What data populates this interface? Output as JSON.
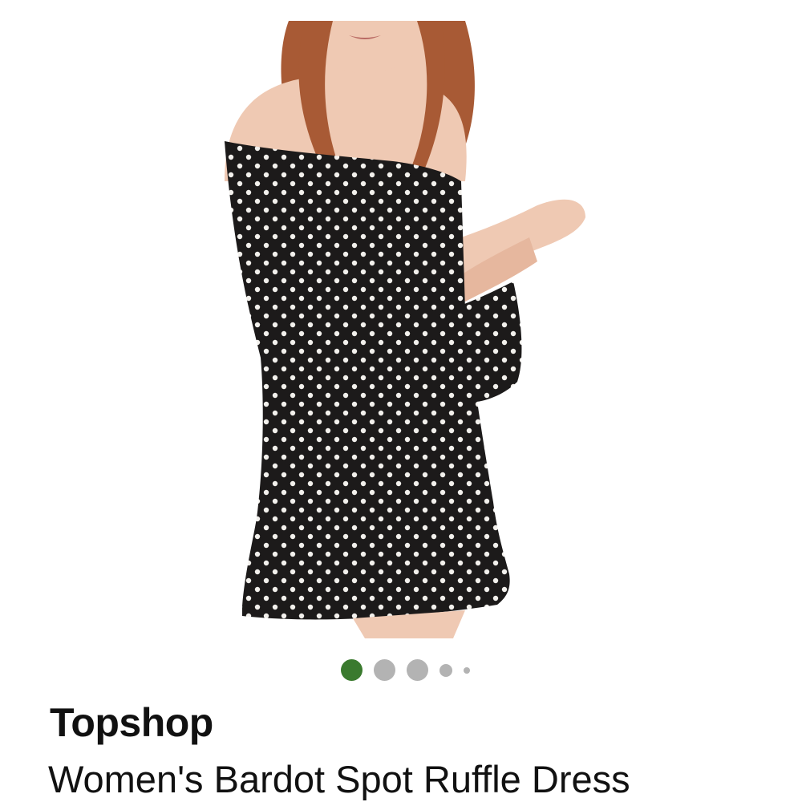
{
  "product": {
    "brand": "Topshop",
    "title": "Women's Bardot Spot Ruffle Dress",
    "image_alt": "Model wearing black polka dot off-shoulder ruffle dress"
  },
  "carousel": {
    "total": 5,
    "active_index": 0,
    "active_color": "#3a7a2e",
    "inactive_color": "#b3b3b3"
  },
  "colors": {
    "dress": "#1c1a1a",
    "dot": "#f2f0ec",
    "skin": "#efc9b3",
    "hair": "#a85a35"
  }
}
